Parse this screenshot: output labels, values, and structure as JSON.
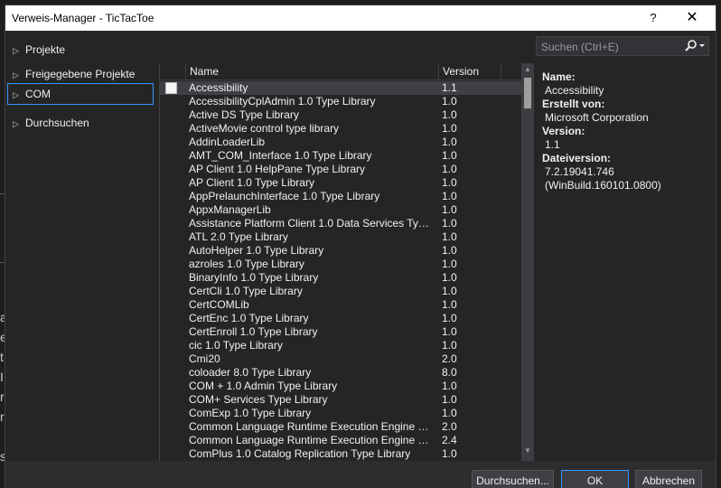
{
  "dialog": {
    "title": "Verweis-Manager - TicTacToe",
    "help": "?",
    "close": "✕"
  },
  "nav": {
    "items": [
      {
        "label": "Projekte"
      },
      {
        "label": "Freigegebene Projekte"
      },
      {
        "label": "COM",
        "selected": true
      },
      {
        "label": "Durchsuchen"
      }
    ]
  },
  "list": {
    "columns": [
      "Name",
      "Version"
    ],
    "rows": [
      {
        "name": "Accessibility",
        "version": "1.1"
      },
      {
        "name": "AccessibilityCplAdmin 1.0 Type Library",
        "version": "1.0"
      },
      {
        "name": "Active DS Type Library",
        "version": "1.0"
      },
      {
        "name": "ActiveMovie control type library",
        "version": "1.0"
      },
      {
        "name": "AddinLoaderLib",
        "version": "1.0"
      },
      {
        "name": "AMT_COM_Interface 1.0 Type Library",
        "version": "1.0"
      },
      {
        "name": "AP Client 1.0 HelpPane Type Library",
        "version": "1.0"
      },
      {
        "name": "AP Client 1.0 Type Library",
        "version": "1.0"
      },
      {
        "name": "AppPrelaunchInterface 1.0 Type Library",
        "version": "1.0"
      },
      {
        "name": "AppxManagerLib",
        "version": "1.0"
      },
      {
        "name": "Assistance Platform Client 1.0 Data Services Type...",
        "version": "1.0"
      },
      {
        "name": "ATL 2.0 Type Library",
        "version": "1.0"
      },
      {
        "name": "AutoHelper 1.0 Type Library",
        "version": "1.0"
      },
      {
        "name": "azroles 1.0 Type Library",
        "version": "1.0"
      },
      {
        "name": "BinaryInfo 1.0 Type Library",
        "version": "1.0"
      },
      {
        "name": "CertCli 1.0 Type Library",
        "version": "1.0"
      },
      {
        "name": "CertCOMLib",
        "version": "1.0"
      },
      {
        "name": "CertEnc 1.0 Type Library",
        "version": "1.0"
      },
      {
        "name": "CertEnroll 1.0 Type Library",
        "version": "1.0"
      },
      {
        "name": "cic 1.0 Type Library",
        "version": "1.0"
      },
      {
        "name": "Cmi20",
        "version": "2.0"
      },
      {
        "name": "coloader 8.0 Type Library",
        "version": "8.0"
      },
      {
        "name": "COM + 1.0 Admin Type Library",
        "version": "1.0"
      },
      {
        "name": "COM+ Services Type Library",
        "version": "1.0"
      },
      {
        "name": "ComExp 1.0 Type Library",
        "version": "1.0"
      },
      {
        "name": "Common Language Runtime Execution Engine 2...",
        "version": "2.0"
      },
      {
        "name": "Common Language Runtime Execution Engine 2...",
        "version": "2.4"
      },
      {
        "name": "ComPlus 1.0 Catalog Replication Type Library",
        "version": "1.0"
      }
    ]
  },
  "search": {
    "placeholder": "Suchen (Ctrl+E)"
  },
  "details": {
    "name_label": "Name:",
    "name_value": "Accessibility",
    "created_label": "Erstellt von:",
    "created_value": "Microsoft Corporation",
    "version_label": "Version:",
    "version_value": "1.1",
    "fileversion_label": "Dateiversion:",
    "fileversion_value": "7.2.19041.746",
    "fileversion_build": "(WinBuild.160101.0800)"
  },
  "footer": {
    "browse": "Durchsuchen...",
    "ok": "OK",
    "cancel": "Abbrechen"
  },
  "background": {
    "chars": [
      "a",
      "e",
      "t",
      "I",
      "r",
      "r",
      "",
      "s"
    ]
  }
}
